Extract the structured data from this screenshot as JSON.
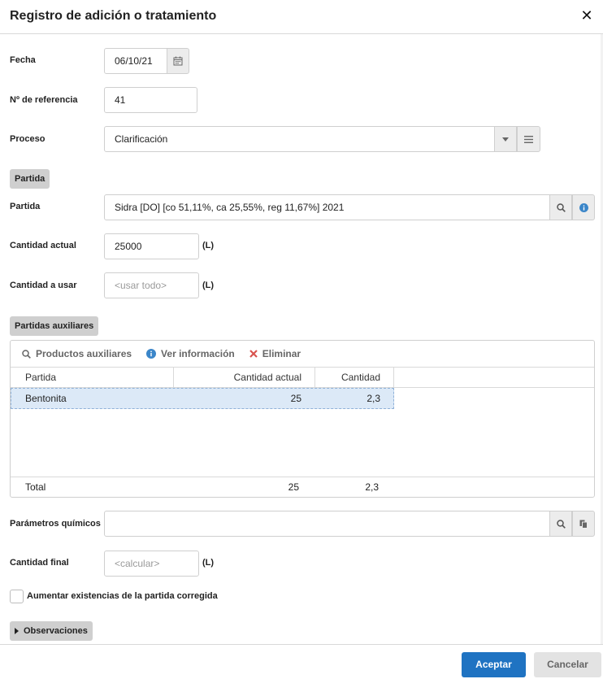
{
  "dialog": {
    "title": "Registro de adición o tratamiento"
  },
  "fields": {
    "fecha": {
      "label": "Fecha",
      "value": "06/10/21"
    },
    "referencia": {
      "label": "Nº de referencia",
      "value": "41"
    },
    "proceso": {
      "label": "Proceso",
      "value": "Clarificación"
    }
  },
  "partida_section": {
    "title": "Partida",
    "partida_label": "Partida",
    "partida_value": "Sidra [DO] [co 51,11%, ca 25,55%, reg 11,67%] 2021",
    "cantidad_actual_label": "Cantidad actual",
    "cantidad_actual_value": "25000",
    "cantidad_actual_unit": "(L)",
    "cantidad_usar_label": "Cantidad a usar",
    "cantidad_usar_placeholder": "<usar todo>",
    "cantidad_usar_unit": "(L)"
  },
  "auxiliares": {
    "title": "Partidas auxiliares",
    "toolbar": {
      "productos": "Productos auxiliares",
      "ver_info": "Ver información",
      "eliminar": "Eliminar"
    },
    "columns": [
      "Partida",
      "Cantidad actual",
      "Cantidad"
    ],
    "rows": [
      {
        "partida": "Bentonita",
        "cantidad_actual": "25",
        "cantidad": "2,3"
      }
    ],
    "total": {
      "label": "Total",
      "cantidad_actual": "25",
      "cantidad": "2,3"
    }
  },
  "parametros": {
    "label": "Parámetros químicos",
    "value": ""
  },
  "cantidad_final": {
    "label": "Cantidad final",
    "placeholder": "<calcular>",
    "unit": "(L)"
  },
  "aumentar": {
    "label": "Aumentar existencias de la partida corregida",
    "checked": false
  },
  "observaciones": {
    "label": "Observaciones"
  },
  "buttons": {
    "accept": "Aceptar",
    "cancel": "Cancelar"
  },
  "colors": {
    "primary": "#1f73c2",
    "info": "#3b86c9",
    "danger": "#d9534f",
    "section_bg": "#cfcfcf",
    "row_selected": "#dce9f7"
  }
}
